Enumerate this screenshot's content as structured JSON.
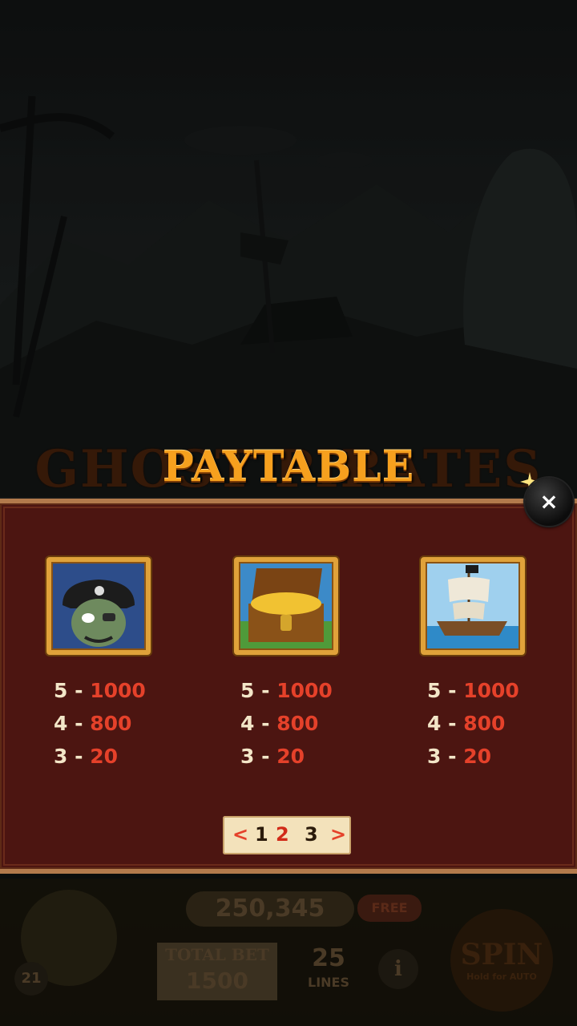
{
  "paytable": {
    "background_title": "GHOST PIRATES",
    "title": "PAYTABLE",
    "close_label": "×",
    "symbols": [
      {
        "name": "pirate-captain",
        "pays": [
          {
            "count": "5",
            "sep": " - ",
            "value": "1000"
          },
          {
            "count": "4",
            "sep": " - ",
            "value": "800"
          },
          {
            "count": "3",
            "sep": " - ",
            "value": "20"
          }
        ]
      },
      {
        "name": "treasure-chest",
        "pays": [
          {
            "count": "5",
            "sep": " - ",
            "value": "1000"
          },
          {
            "count": "4",
            "sep": " - ",
            "value": "800"
          },
          {
            "count": "3",
            "sep": " - ",
            "value": "20"
          }
        ]
      },
      {
        "name": "pirate-ship",
        "pays": [
          {
            "count": "5",
            "sep": " - ",
            "value": "1000"
          },
          {
            "count": "4",
            "sep": " - ",
            "value": "800"
          },
          {
            "count": "3",
            "sep": " - ",
            "value": "20"
          }
        ]
      }
    ],
    "pager": {
      "prev": "<",
      "pages": [
        "1",
        "2",
        "3"
      ],
      "current": "2",
      "next": ">"
    }
  },
  "hud": {
    "balance": "250,345",
    "free_label": "FREE",
    "total_bet_label": "TOTAL BET",
    "total_bet": "1500",
    "lines_count": "25",
    "lines_label": "LINES",
    "level": "21",
    "info_label": "i",
    "spin_label": "SPIN",
    "spin_hint": "Hold for AUTO"
  },
  "colors": {
    "panel": "#4c1511",
    "gold": "#f6a01e",
    "value_red": "#e5412a",
    "count_cream": "#f3e6c8"
  }
}
